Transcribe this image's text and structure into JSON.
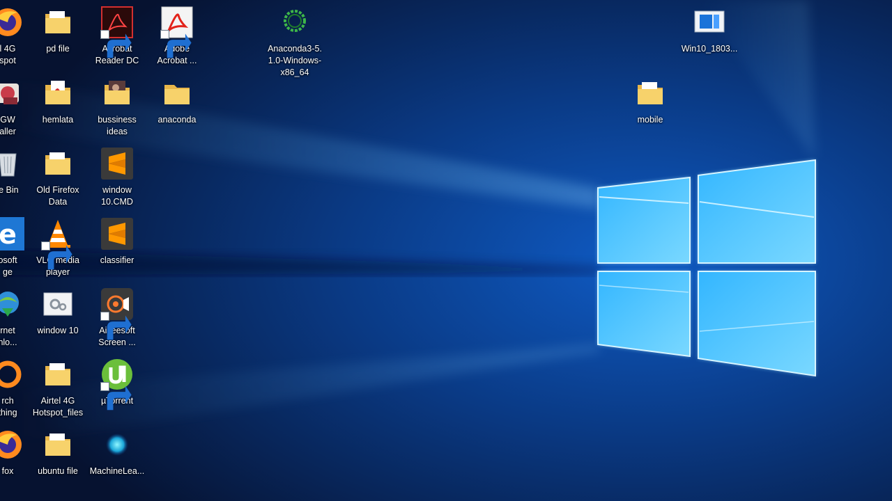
{
  "desktop": {
    "wallpaper": "windows-10-hero-wallpaper",
    "colors": {
      "bg_dark": "#071433",
      "bg_mid": "#0b3e86",
      "window_light": "#5cc8ff",
      "label_text": "#ffffff"
    },
    "icons": [
      {
        "label": "l 4G\nspot",
        "icon": "firefox-icon"
      },
      {
        "label": "GW\naller",
        "icon": "mingw-installer-icon"
      },
      {
        "label": "le Bin",
        "icon": "recycle-bin-icon"
      },
      {
        "label": "osoft\nge",
        "icon": "edge-icon"
      },
      {
        "label": "rnet\nnlo...",
        "icon": "internet-download-manager-icon"
      },
      {
        "label": "rch\nthing",
        "icon": "everything-search-icon"
      },
      {
        "label": "fox",
        "icon": "firefox-icon"
      },
      {
        "label": "pd file",
        "icon": "folder-icon"
      },
      {
        "label": "hemlata",
        "icon": "folder-pdf-icon"
      },
      {
        "label": "Old Firefox\nData",
        "icon": "folder-icon"
      },
      {
        "label": "VLC media\nplayer",
        "icon": "vlc-icon"
      },
      {
        "label": "window 10",
        "icon": "settings-file-icon"
      },
      {
        "label": "Airtel 4G\nHotspot_files",
        "icon": "folder-icon"
      },
      {
        "label": "ubuntu file",
        "icon": "folder-icon"
      },
      {
        "label": "Acrobat\nReader DC",
        "icon": "acrobat-reader-icon"
      },
      {
        "label": "bussiness\nideas",
        "icon": "folder-photo-icon"
      },
      {
        "label": "window\n10.CMD",
        "icon": "sublime-text-icon"
      },
      {
        "label": "classifier",
        "icon": "sublime-text-icon"
      },
      {
        "label": "Aiseesoft\nScreen ...",
        "icon": "aiseesoft-recorder-icon"
      },
      {
        "label": "µTorrent",
        "icon": "utorrent-icon"
      },
      {
        "label": "MachineLea...",
        "icon": "machine-learning-icon"
      },
      {
        "label": "Adobe\nAcrobat ...",
        "icon": "adobe-acrobat-icon"
      },
      {
        "label": "anaconda",
        "icon": "folder-icon"
      },
      {
        "label": "Anaconda3-5.\n1.0-Windows-\nx86_64",
        "icon": "anaconda-installer-icon"
      },
      {
        "label": "Win10_1803...",
        "icon": "iso-file-icon"
      },
      {
        "label": "mobile",
        "icon": "folder-icon"
      }
    ]
  }
}
